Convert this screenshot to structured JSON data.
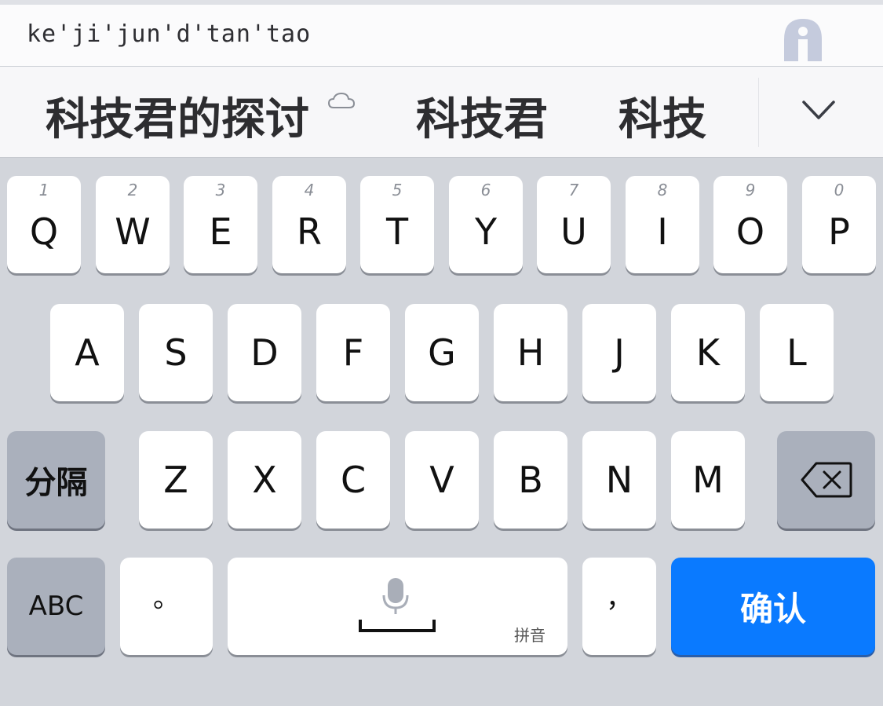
{
  "input": {
    "pinyin": "ke'ji'jun'd'tan'tao"
  },
  "candidates": [
    {
      "text": "科技君的探讨"
    },
    {
      "text": "科技君"
    },
    {
      "text": "科技"
    }
  ],
  "keyboard": {
    "row1": [
      {
        "letter": "Q",
        "num": "1"
      },
      {
        "letter": "W",
        "num": "2"
      },
      {
        "letter": "E",
        "num": "3"
      },
      {
        "letter": "R",
        "num": "4"
      },
      {
        "letter": "T",
        "num": "5"
      },
      {
        "letter": "Y",
        "num": "6"
      },
      {
        "letter": "U",
        "num": "7"
      },
      {
        "letter": "I",
        "num": "8"
      },
      {
        "letter": "O",
        "num": "9"
      },
      {
        "letter": "P",
        "num": "0"
      }
    ],
    "row2": [
      "A",
      "S",
      "D",
      "F",
      "G",
      "H",
      "J",
      "K",
      "L"
    ],
    "row3": [
      "Z",
      "X",
      "C",
      "V",
      "B",
      "N",
      "M"
    ],
    "separator_label": "分隔",
    "abc_label": "ABC",
    "period_label": "。",
    "comma_label": "，",
    "space_sublabel": "拼音",
    "confirm_label": "确认"
  },
  "colors": {
    "primary": "#0a7aff",
    "keyboard_bg": "#d2d5db",
    "function_key": "#aab0bc"
  },
  "icons": {
    "assist": "hand-assist-icon",
    "cloud": "cloud-icon",
    "expand": "chevron-down-icon",
    "delete": "backspace-icon",
    "mic": "microphone-icon"
  }
}
